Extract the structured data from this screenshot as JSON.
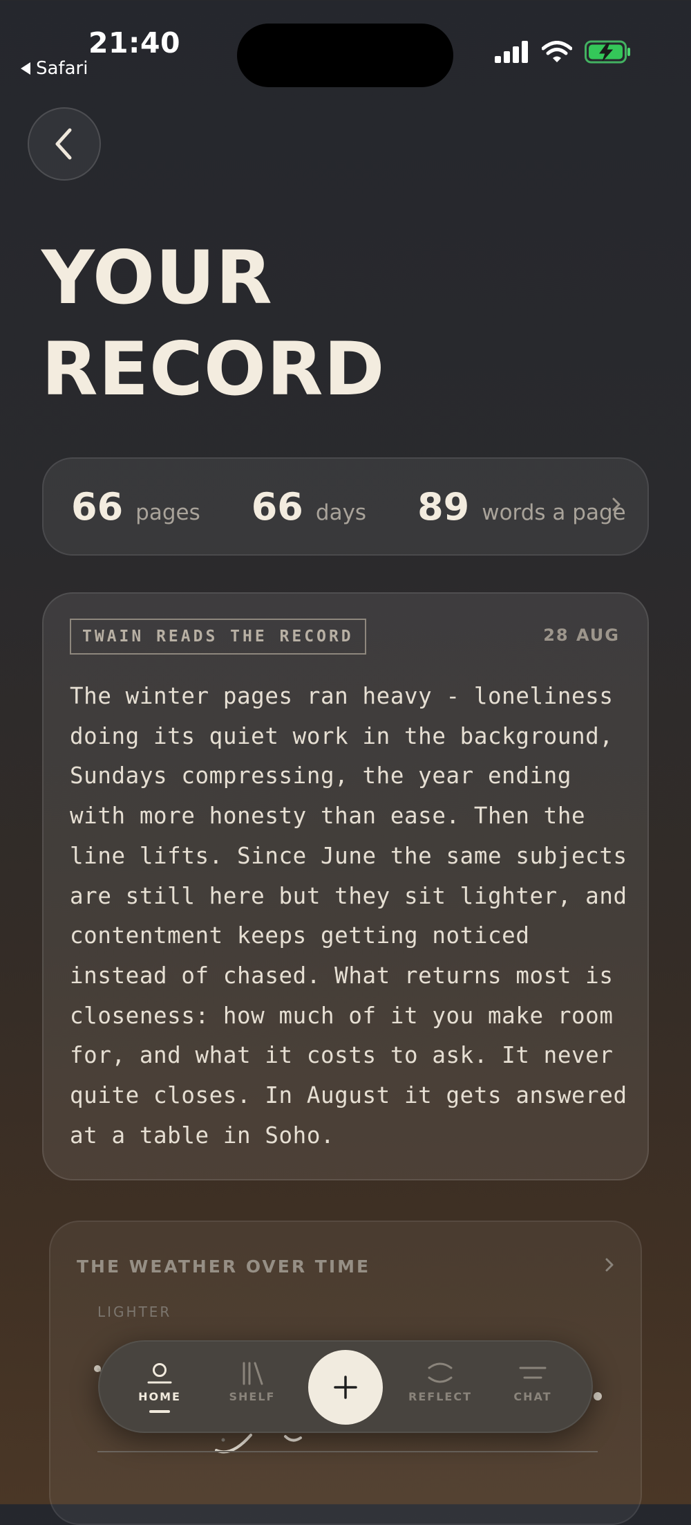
{
  "status_bar": {
    "time": "21:40",
    "back_app": "Safari",
    "icons": [
      "signal-icon",
      "wifi-icon",
      "battery-charging-icon"
    ]
  },
  "nav": {
    "back_icon": "chevron-left-icon"
  },
  "title": {
    "line1": "YOUR",
    "line2": "RECORD"
  },
  "stats": {
    "pages_value": "66",
    "pages_label": "pages",
    "days_value": "66",
    "days_label": "days",
    "words_value": "89",
    "words_label": "words a page"
  },
  "reading": {
    "tag": "TWAIN READS THE RECORD",
    "date": "28 AUG",
    "text": "The winter pages ran heavy - loneliness doing its quiet work in the background, Sundays compressing, the year ending with more honesty than ease. Then the line lifts. Since June the same subjects are still here but they sit lighter, and contentment keeps getting noticed instead of chased. What returns most is closeness: how much of it you make room for, and what it costs to ask. It never quite closes. In August it gets answered at a table in Soho."
  },
  "weather": {
    "title": "THE WEATHER OVER TIME",
    "axis_top_label": "LIGHTER"
  },
  "bottom_nav": {
    "items": [
      {
        "label": "HOME",
        "icon": "home-icon",
        "active": true
      },
      {
        "label": "SHELF",
        "icon": "shelf-icon",
        "active": false
      },
      {
        "label": "REFLECT",
        "icon": "reflect-icon",
        "active": false
      },
      {
        "label": "CHAT",
        "icon": "chat-icon",
        "active": false
      }
    ],
    "add_icon": "plus-icon"
  },
  "colors": {
    "accent_cream": "#f1ebdf",
    "battery_green": "#34c759",
    "muted_text": "#a9a39a"
  }
}
